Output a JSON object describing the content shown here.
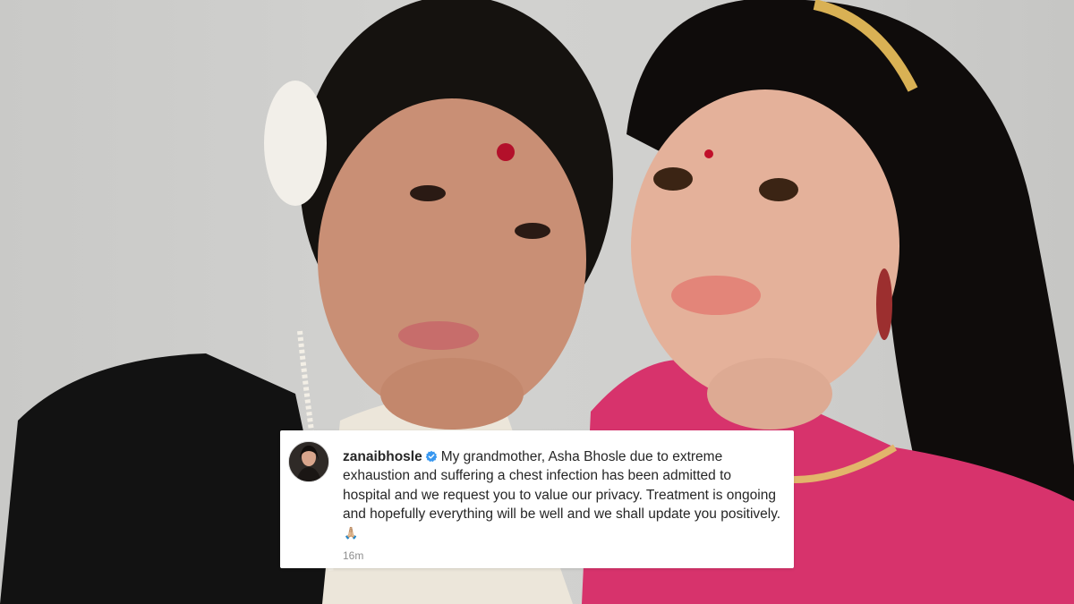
{
  "post": {
    "username": "zanaibhosle",
    "caption": "My grandmother, Asha Bhosle due to extreme exhaustion and suffering a chest infection has been admitted to hospital and we request you to value our privacy. Treatment is ongoing and hopefully everything will be well and we shall update you positively.",
    "emoji": "🙏🏼",
    "timestamp": "16m"
  },
  "icons": {
    "verified": "verified-badge-icon",
    "avatar": "profile-avatar"
  },
  "colors": {
    "verified_blue": "#3897f0",
    "caption_text": "#262626",
    "muted_text": "#8e8e8e",
    "card_bg": "#ffffff"
  }
}
